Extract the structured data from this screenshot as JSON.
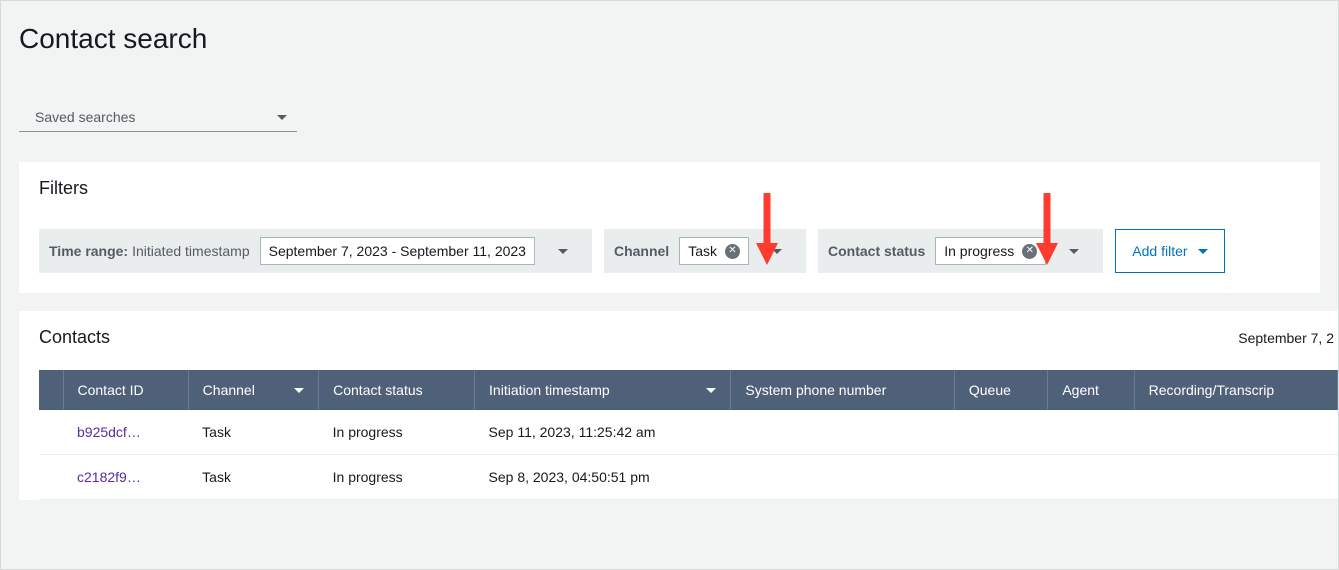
{
  "pageTitle": "Contact search",
  "savedSearches": {
    "label": "Saved searches"
  },
  "filters": {
    "title": "Filters",
    "timeRange": {
      "label": "Time range:",
      "sublabel": "Initiated timestamp",
      "value": "September 7, 2023 - September 11, 2023"
    },
    "channel": {
      "label": "Channel",
      "value": "Task"
    },
    "contactStatus": {
      "label": "Contact status",
      "value": "In progress"
    },
    "addFilter": "Add filter"
  },
  "contacts": {
    "title": "Contacts",
    "rangeText": "September 7, 2",
    "columns": {
      "contactId": "Contact ID",
      "channel": "Channel",
      "contactStatus": "Contact status",
      "initiationTimestamp": "Initiation timestamp",
      "systemPhoneNumber": "System phone number",
      "queue": "Queue",
      "agent": "Agent",
      "recording": "Recording/Transcrip"
    },
    "rows": [
      {
        "id": "b925dcf…",
        "channel": "Task",
        "status": "In progress",
        "timestamp": "Sep 11, 2023, 11:25:42 am"
      },
      {
        "id": "c2182f9…",
        "channel": "Task",
        "status": "In progress",
        "timestamp": "Sep 8, 2023, 04:50:51 pm"
      }
    ]
  }
}
